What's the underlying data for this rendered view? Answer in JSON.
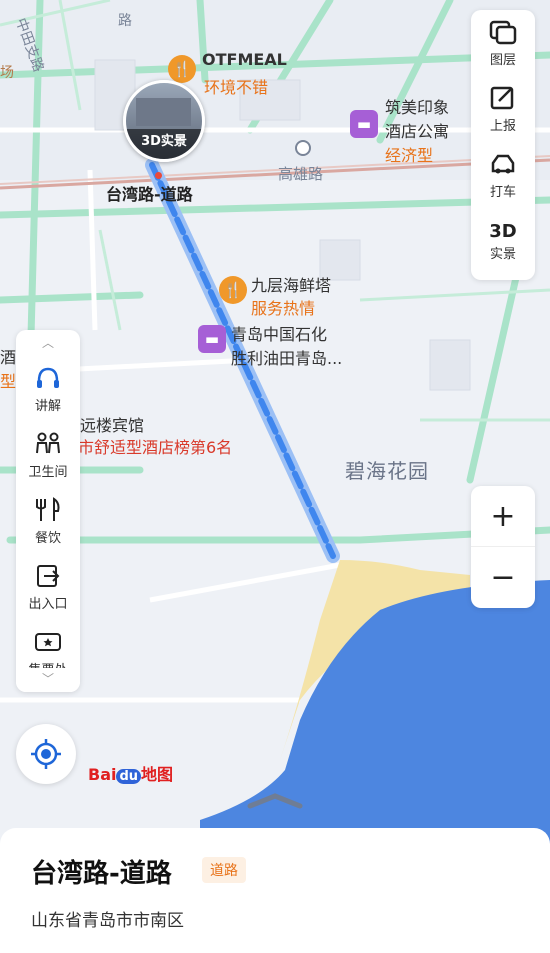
{
  "map": {
    "selected_road": "台湾路-道路",
    "labels": {
      "otfmeal_name": "OTFMEAL",
      "otfmeal_tag": "环境不错",
      "hotel1_name_line1": "筑美印象",
      "hotel1_name_line2": "酒店公寓",
      "hotel1_tag": "经济型",
      "metro_station": "高雄路",
      "seafood_name": "九层海鲜塔",
      "seafood_tag": "服务热情",
      "sinopec_line1": "青岛中国石化",
      "sinopec_line2": "胜利油田青岛...",
      "hotel2_name": "远楼宾馆",
      "hotel2_tag": "市舒适型酒店榜第6名",
      "area": "碧海花园",
      "street_tl": "中田支路",
      "street_top": "路",
      "partial_left1": "场",
      "partial_left2": "酒",
      "partial_left3": "型"
    },
    "streetview_badge": "3D实景"
  },
  "toolbar": {
    "layers": "图层",
    "report": "上报",
    "taxi": "打车",
    "realview": "实景",
    "realview_icon_text": "3D"
  },
  "sidebar": {
    "items": [
      "讲解",
      "卫生间",
      "餐饮",
      "出入口",
      "售票处"
    ]
  },
  "zoom": {
    "in": "+",
    "out": "−"
  },
  "brand": {
    "bai": "Bai",
    "du": "du",
    "map": "地图"
  },
  "bottom_sheet": {
    "title": "台湾路-道路",
    "type_badge": "道路",
    "address": "山东省青岛市市南区"
  },
  "colors": {
    "route": "#3f86ee",
    "water": "#4d86e0",
    "beach": "#f4e3a8",
    "road_green": "#a9e3c9",
    "accent_orange": "#e8731a"
  }
}
